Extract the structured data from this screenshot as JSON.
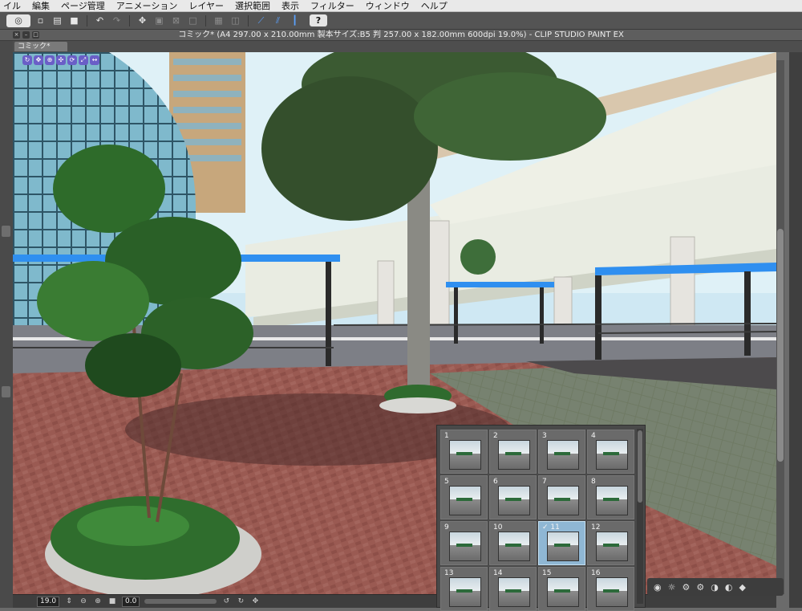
{
  "menubar": {
    "items": [
      "イル",
      "編集",
      "ページ管理",
      "アニメーション",
      "レイヤー",
      "選択範囲",
      "表示",
      "フィルター",
      "ウィンドウ",
      "ヘルプ"
    ]
  },
  "toolbar": {
    "buttons": [
      "app-logo-icon",
      "new-file-icon",
      "open-file-icon",
      "save-icon",
      "undo-icon",
      "redo-icon",
      "transform-icon",
      "select-all-icon",
      "deselect-icon",
      "clear-icon",
      "fill-icon",
      "ruler-snap-icon",
      "special-ruler-snap-icon",
      "grid-snap-icon"
    ],
    "help_label": "?"
  },
  "window": {
    "title": "コミック* (A4 297.00 x 210.00mm 製本サイズ:B5 判 257.00 x 182.00mm 600dpi 19.0%)  - CLIP STUDIO PAINT EX"
  },
  "document": {
    "tab_label": "コミック*"
  },
  "status": {
    "zoom": "19.0",
    "angle": "0.0"
  },
  "pages": {
    "items": [
      {
        "num": "1"
      },
      {
        "num": "2"
      },
      {
        "num": "3"
      },
      {
        "num": "4"
      },
      {
        "num": "5"
      },
      {
        "num": "6"
      },
      {
        "num": "7"
      },
      {
        "num": "8"
      },
      {
        "num": "9"
      },
      {
        "num": "10"
      },
      {
        "num": "✓ 11"
      },
      {
        "num": "12"
      },
      {
        "num": "13"
      },
      {
        "num": "14"
      },
      {
        "num": "15"
      },
      {
        "num": "16"
      }
    ],
    "selected": "11"
  },
  "colors": {
    "accent": "#2f8ff0",
    "panel": "#494949",
    "selected_page": "#8fb7d4"
  }
}
